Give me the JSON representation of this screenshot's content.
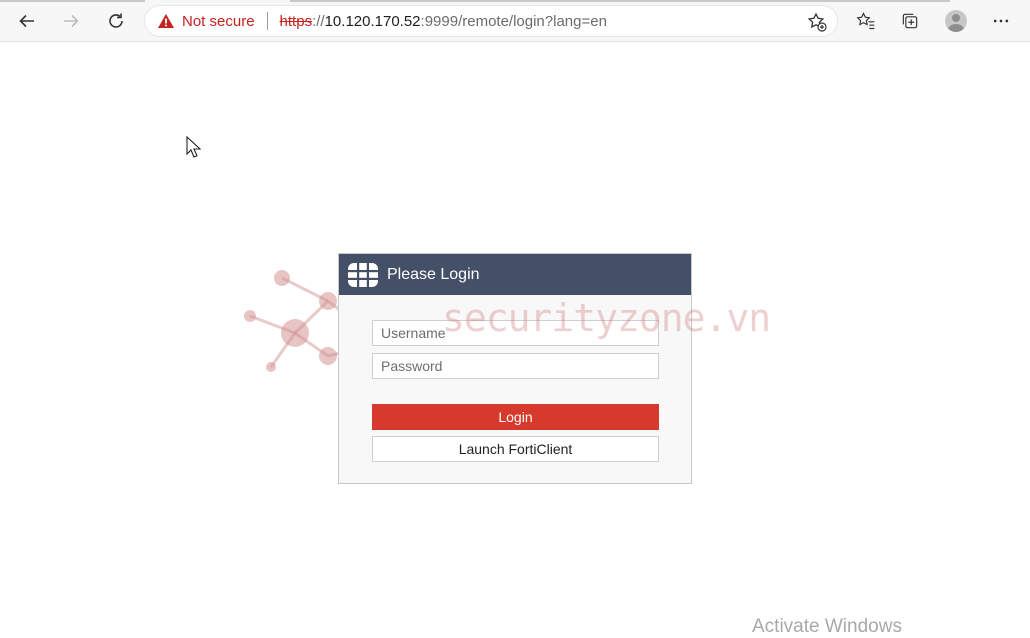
{
  "address_bar": {
    "security_label": "Not secure",
    "scheme": "https",
    "separator": "://",
    "host": "10.120.170.52",
    "path": ":9999/remote/login?lang=en"
  },
  "watermark": "securityzone.vn",
  "login": {
    "title": "Please Login",
    "username_placeholder": "Username",
    "password_placeholder": "Password",
    "login_label": "Login",
    "forticlient_label": "Launch FortiClient"
  },
  "os_overlay": "Activate Windows",
  "colors": {
    "header_bg": "#445068",
    "login_button": "#d63a2c",
    "not_secure": "#c5221f"
  }
}
